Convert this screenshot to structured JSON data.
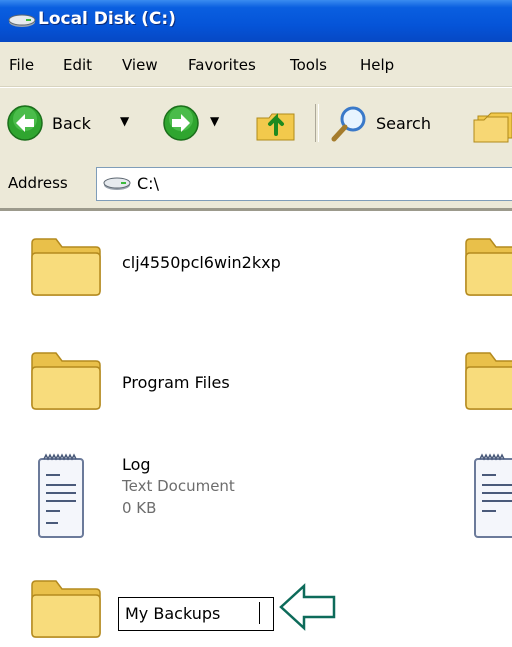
{
  "window": {
    "title": "Local Disk (C:)"
  },
  "menu": [
    "File",
    "Edit",
    "View",
    "Favorites",
    "Tools",
    "Help"
  ],
  "toolbar": {
    "back_label": "Back",
    "search_label": "Search"
  },
  "address": {
    "label": "Address",
    "value": "C:\\"
  },
  "files": [
    {
      "name": "clj4550pcl6win2kxp",
      "type": "folder"
    },
    {
      "name": "Program Files",
      "type": "folder"
    },
    {
      "name": "Log",
      "type": "text-document",
      "detail": "Text Document",
      "size": "0 KB"
    },
    {
      "name": "My Backups",
      "type": "folder",
      "renaming": true
    }
  ],
  "colors": {
    "titlebar": "#0554d8",
    "chrome": "#ece9d8",
    "folder": "#f7d774",
    "callout_arrow": "#0d6b5a"
  }
}
